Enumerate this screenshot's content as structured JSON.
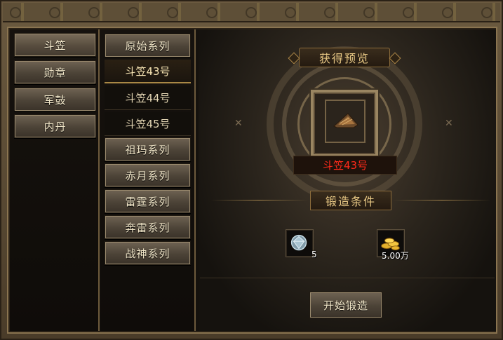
{
  "categories": [
    {
      "label": "斗笠"
    },
    {
      "label": "勋章"
    },
    {
      "label": "军鼓"
    },
    {
      "label": "内丹"
    }
  ],
  "series": {
    "original": "原始系列",
    "subitems": [
      "斗笠43号",
      "斗笠44号",
      "斗笠45号"
    ],
    "selected_subitem": "斗笠43号",
    "others": [
      "祖玛系列",
      "赤月系列",
      "雷霆系列",
      "奔雷系列",
      "战神系列"
    ]
  },
  "preview": {
    "title": "获得预览",
    "item_name": "斗笠43号",
    "item_name_color": "#ff2a1a",
    "item_icon": "hat-icon"
  },
  "conditions": {
    "title": "锻造条件",
    "materials": [
      {
        "icon": "diamond-icon",
        "count": "5"
      },
      {
        "icon": "gold-coins-icon",
        "count": "5.00万"
      }
    ]
  },
  "forge_button": "开始锻造"
}
